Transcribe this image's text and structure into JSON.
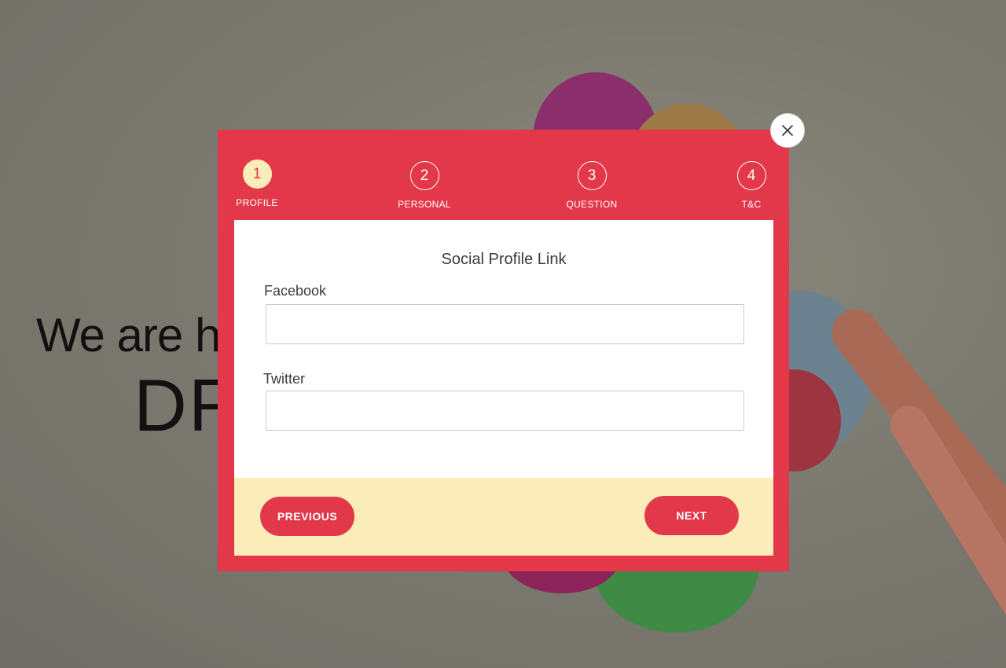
{
  "background": {
    "hero_line1": "We are he",
    "hero_line2": "DR"
  },
  "modal": {
    "close_icon": "close-icon",
    "steps": [
      {
        "number": "1",
        "label": "PROFILE",
        "active": true
      },
      {
        "number": "2",
        "label": "PERSONAL",
        "active": false
      },
      {
        "number": "3",
        "label": "QUESTION",
        "active": false
      },
      {
        "number": "4",
        "label": "T&C",
        "active": false
      }
    ],
    "title": "Social Profile Link",
    "fields": {
      "facebook": {
        "label": "Facebook",
        "value": "",
        "placeholder": ""
      },
      "twitter": {
        "label": "Twitter",
        "value": "",
        "placeholder": ""
      }
    },
    "buttons": {
      "previous": "PREVIOUS",
      "next": "NEXT"
    }
  },
  "colors": {
    "accent": "#e33849",
    "footer": "#faedb9",
    "active_step": "#faedb9"
  }
}
